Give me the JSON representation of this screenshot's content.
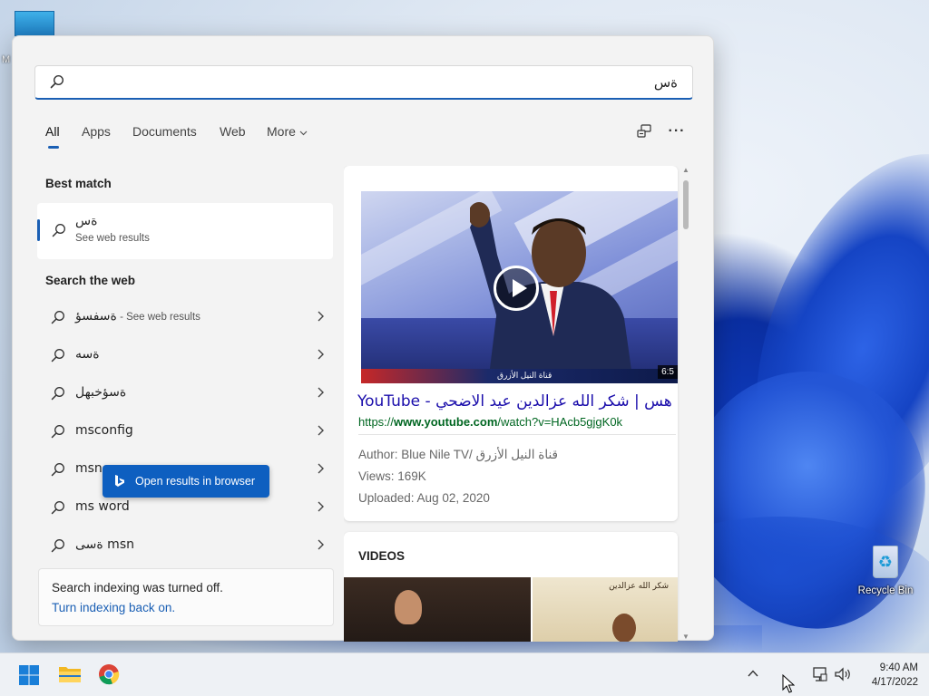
{
  "desktop": {
    "top_icon_label": "M",
    "recycle_bin_label": "Recycle Bin"
  },
  "search": {
    "query": "ةس",
    "tabs": [
      {
        "label": "All",
        "active": true
      },
      {
        "label": "Apps"
      },
      {
        "label": "Documents"
      },
      {
        "label": "Web"
      },
      {
        "label": "More"
      }
    ],
    "tools": {
      "share_icon": "share-device-icon",
      "more_icon": "ellipsis-icon",
      "more_glyph": "···"
    }
  },
  "left": {
    "best_match_title": "Best match",
    "best_match": {
      "query": "ةس",
      "subtitle": "See web results"
    },
    "search_web_title": "Search the web",
    "web_items": [
      {
        "text": "ةسفسؤ",
        "suffix": " - See web results"
      },
      {
        "text": "ةسه",
        "suffix": ""
      },
      {
        "text": "ةسؤخبهل",
        "suffix": ""
      },
      {
        "text": "msconfig",
        "suffix": ""
      },
      {
        "text": "msn",
        "suffix": ""
      },
      {
        "text": "ms word",
        "suffix": ""
      },
      {
        "text": "ةسى msn",
        "suffix": ""
      }
    ],
    "indexing": {
      "line1": "Search indexing was turned off.",
      "link": "Turn indexing back on."
    }
  },
  "preview": {
    "video_duration": "6:5",
    "ticker_text": "قناة النيل الأزرق",
    "title": "YouTube - هس | شكر الله عزالدين عيد الاضحي",
    "url_prefix": "https://",
    "url_domain": "www.youtube.com",
    "url_path": "/watch?v=HAcb5gjgK0k",
    "author": "Author: Blue Nile TV/ قناة النيل الأزرق",
    "views": "Views: 169K",
    "uploaded": "Uploaded: Aug 02, 2020",
    "videos_title": "VIDEOS",
    "video2_caption": "شكر الله عزالدين",
    "open_button": "Open results in browser"
  },
  "taskbar": {
    "time": "9:40 AM",
    "date": "4/17/2022"
  },
  "colors": {
    "accent": "#1a5fb4",
    "link": "#1a0dab",
    "url": "#006621",
    "button": "#0e5fc0"
  }
}
